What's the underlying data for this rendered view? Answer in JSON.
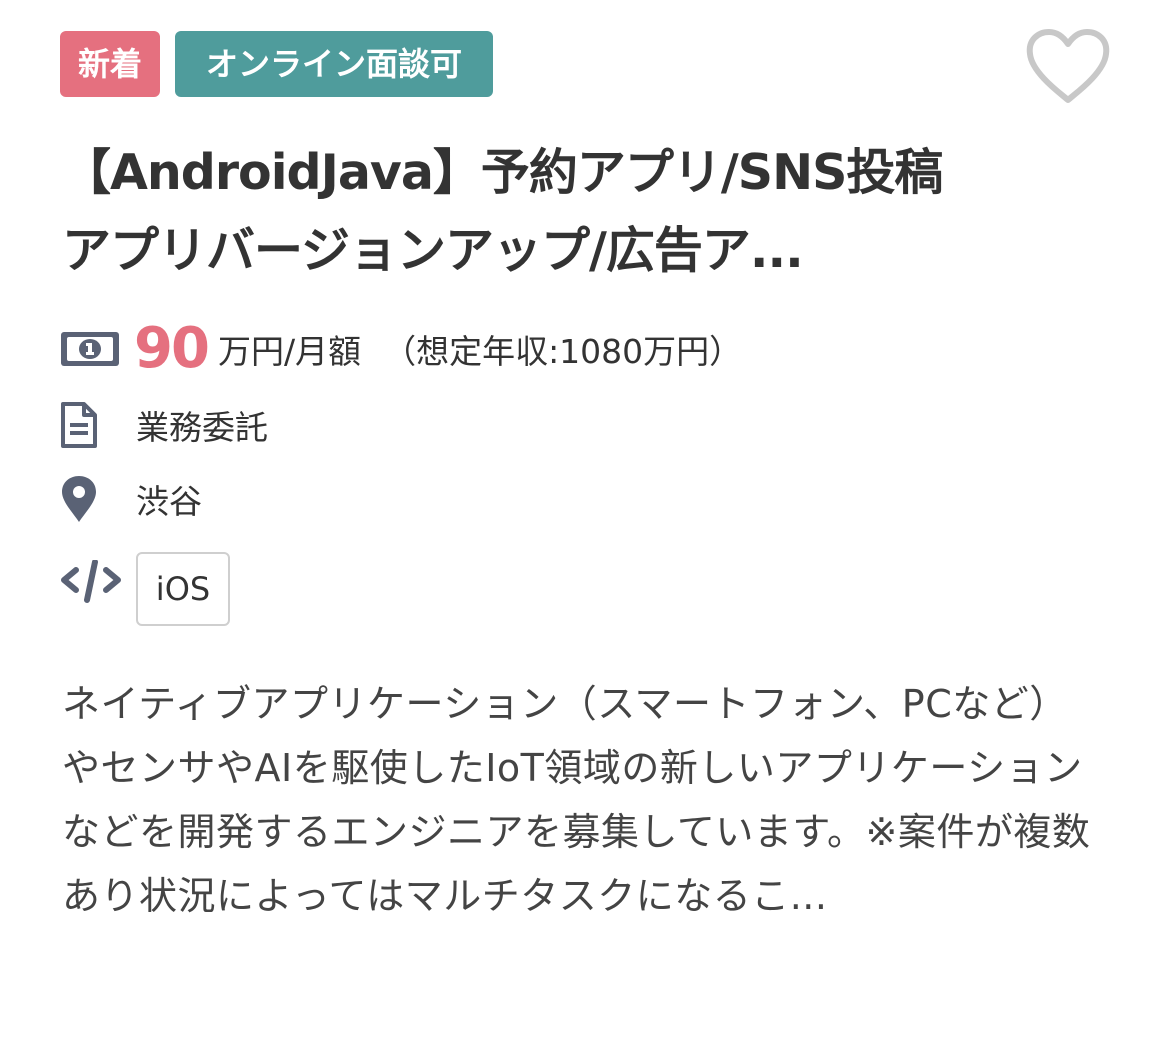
{
  "tags": {
    "new": "新着",
    "online": "オンライン面談可"
  },
  "favorite": {
    "icon": "heart-outline-icon",
    "color": "#c8c8c8"
  },
  "title_line1": "【AndroidJava】予約アプリ/SNS投稿",
  "title_line2": "アプリバージョンアップ/広告ア...",
  "salary": {
    "icon": "money-bill-icon",
    "amount": "90",
    "unit": "万円/月額",
    "estimate": "（想定年収:1080万円）",
    "accent": "#e5707f"
  },
  "contract": {
    "icon": "document-icon",
    "label": "業務委託"
  },
  "location": {
    "icon": "map-pin-icon",
    "label": "渋谷"
  },
  "skills": {
    "icon": "code-icon",
    "items": [
      "iOS"
    ]
  },
  "description": "ネイティブアプリケーション（スマートフォン、PCなど）やセンサやAIを駆使したIoT領域の新しいアプリケーションなどを開発するエンジニアを募集しています。※案件が複数あり状況によってはマルチタスクになるこ...",
  "colors": {
    "tag_new": "#e5707f",
    "tag_online": "#4f9c9c",
    "icon": "#5a6275"
  }
}
